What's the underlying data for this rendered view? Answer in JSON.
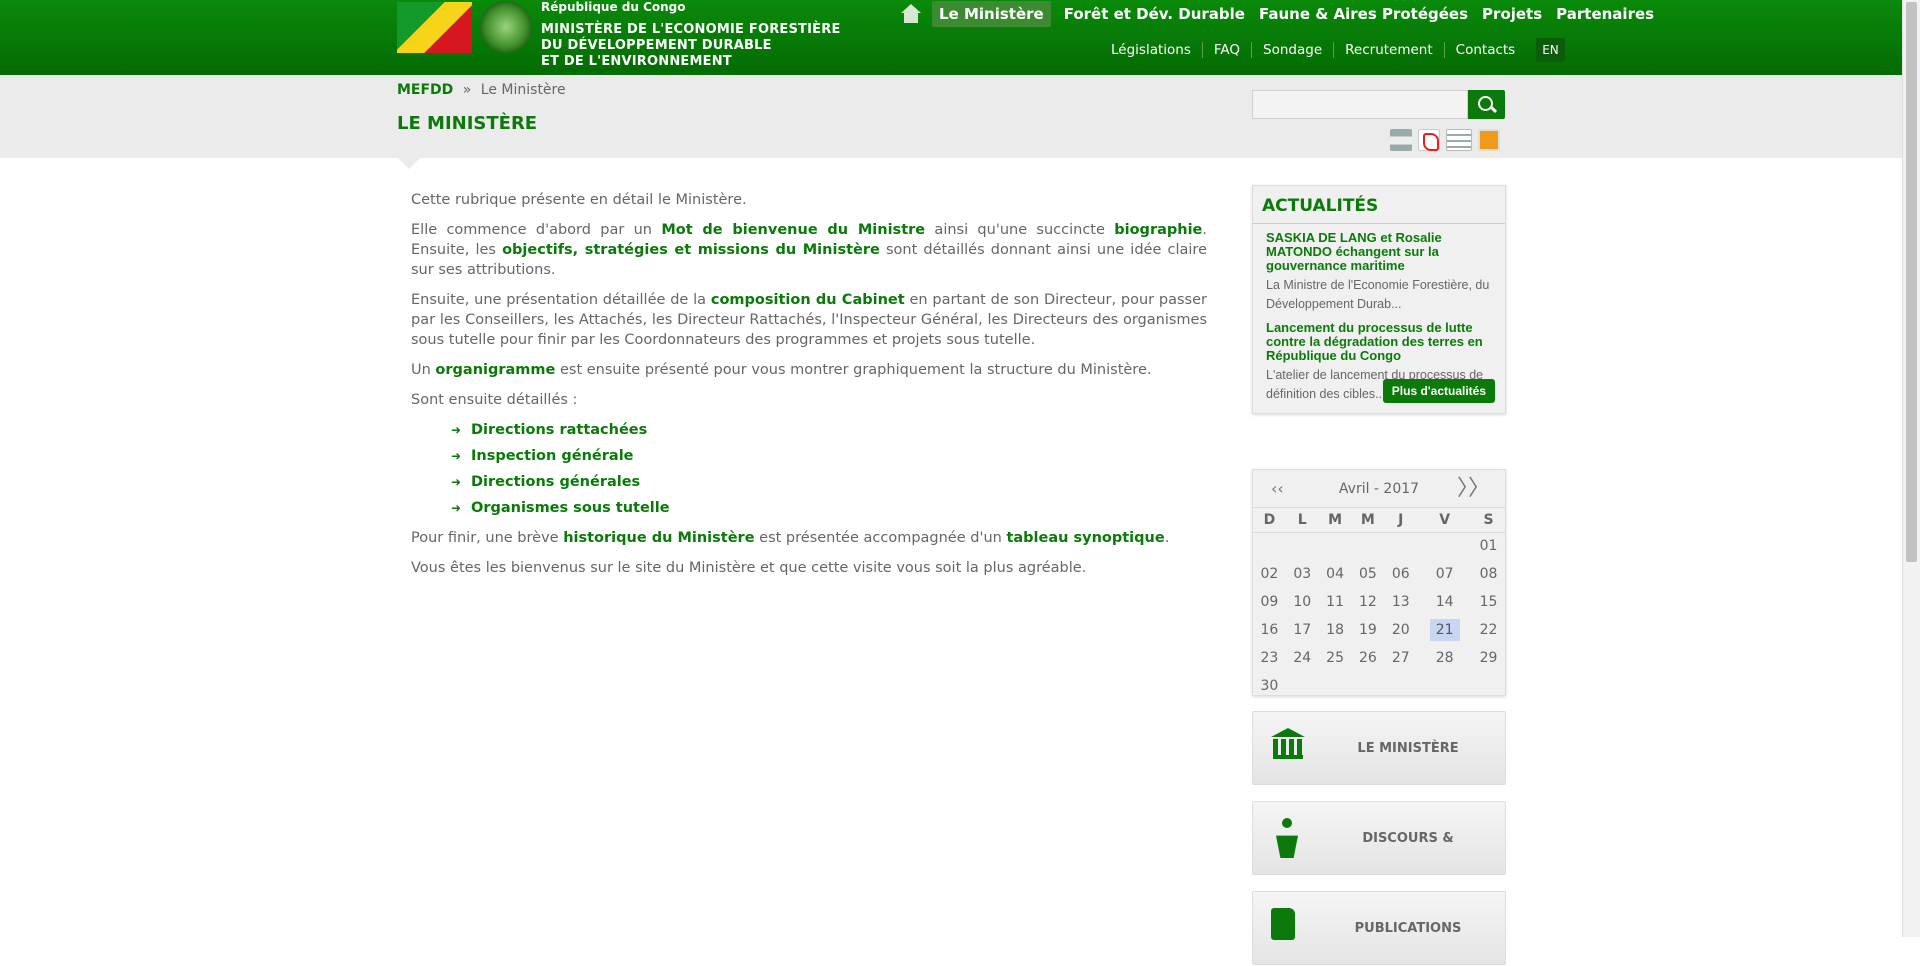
{
  "header": {
    "country": "République du Congo",
    "ministry_line1": "MINISTÈRE DE L'ECONOMIE FORESTIÈRE",
    "ministry_line2": "DU DÉVELOPPEMENT DURABLE",
    "ministry_line3": "ET DE L'ENVIRONNEMENT",
    "home_icon": "home-icon",
    "nav": [
      "Le Ministère",
      "Forêt et Dév. Durable",
      "Faune & Aires Protégées",
      "Projets",
      "Partenaires"
    ],
    "subnav": [
      "Législations",
      "FAQ",
      "Sondage",
      "Recrutement",
      "Contacts"
    ],
    "lang": "EN",
    "color_primary": "#0b7a0b"
  },
  "breadcrumb": {
    "home": "MEFDD",
    "separator": "»",
    "current": "Le Ministère"
  },
  "page_title": "LE MINISTÈRE",
  "search": {
    "placeholder": ""
  },
  "tools": [
    "print-icon",
    "pdf-icon",
    "email-icon",
    "rss-icon"
  ],
  "content": {
    "p1": "Cette rubrique présente en détail le Ministère.",
    "p2_a": "Elle commence d'abord par un ",
    "p2_link1": "Mot de bienvenue du Ministre",
    "p2_b": " ainsi qu'une succincte ",
    "p2_link2": "biographie",
    "p2_c": ". Ensuite, les ",
    "p2_link3": "objectifs, stratégies et missions du Ministère",
    "p2_d": " sont détaillés donnant ainsi une idée claire sur ses attributions.",
    "p3_a": "Ensuite, une présentation détaillée de la ",
    "p3_link": "composition du Cabinet",
    "p3_b": " en partant de son Directeur, pour passer par les Conseillers, les Attachés, les Directeur Rattachés, l'Inspecteur Général, les Directeurs des organismes sous tutelle pour finir par les Coordonnateurs des programmes et projets sous tutelle.",
    "p4_a": "Un ",
    "p4_link": "organigramme",
    "p4_b": " est ensuite présenté pour vous montrer graphiquement la structure du Ministère.",
    "p5": "Sont ensuite détaillés :",
    "list": [
      "Directions rattachées",
      "Inspection générale",
      "Directions générales",
      "Organismes sous tutelle"
    ],
    "p6_a": "Pour finir, une brève ",
    "p6_link1": "historique du Ministère",
    "p6_b": " est présentée accompagnée d'un ",
    "p6_link2": "tableau synoptique",
    "p6_c": ".",
    "p7": "Vous êtes les bienvenus sur le site du Ministère et que cette visite vous soit la plus agréable."
  },
  "news": {
    "title": "ACTUALITÉS",
    "items": [
      {
        "title": "SASKIA DE LANG et Rosalie MATONDO échangent sur la gouvernance maritime",
        "summary": "La Ministre de l'Economie Forestière, du Développement Durab..."
      },
      {
        "title": "Lancement du processus de lutte contre la dégradation des terres en République du Congo",
        "summary": "L'atelier de lancement du processus de définition des cibles..."
      }
    ],
    "more": "Plus d'actualités"
  },
  "calendar": {
    "prev": "‹‹",
    "next": "〉〉",
    "month": "Avril - 2017",
    "days": [
      "D",
      "L",
      "M",
      "M",
      "J",
      "V",
      "S"
    ],
    "weeks": [
      [
        "",
        "",
        "",
        "",
        "",
        "",
        "01"
      ],
      [
        "02",
        "03",
        "04",
        "05",
        "06",
        "07",
        "08"
      ],
      [
        "09",
        "10",
        "11",
        "12",
        "13",
        "14",
        "15"
      ],
      [
        "16",
        "17",
        "18",
        "19",
        "20",
        "21",
        "22"
      ],
      [
        "23",
        "24",
        "25",
        "26",
        "27",
        "28",
        "29"
      ],
      [
        "30",
        "",
        "",
        "",
        "",
        "",
        ""
      ]
    ],
    "today": "21",
    "today_color": "#c7d7f3"
  },
  "tiles": [
    {
      "label": "LE MINISTÈRE",
      "icon": "bank-icon"
    },
    {
      "label": "DISCOURS & ALLOCUTIONS",
      "icon": "podium-icon"
    },
    {
      "label": "PUBLICATIONS",
      "icon": "book-icon"
    }
  ]
}
